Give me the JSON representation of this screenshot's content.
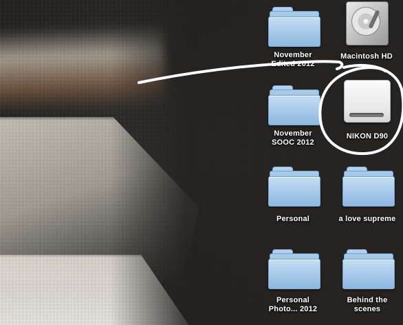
{
  "desktop": {
    "icons": [
      {
        "label": "November\nEdited 2012",
        "type": "folder"
      },
      {
        "label": "Macintosh HD",
        "type": "hard-drive"
      },
      {
        "label": "November\nSOOC 2012",
        "type": "folder"
      },
      {
        "label": "NIKON D90",
        "type": "external-drive"
      },
      {
        "label": "Personal",
        "type": "folder"
      },
      {
        "label": "a love supreme",
        "type": "folder"
      },
      {
        "label": "Personal\nPhoto... 2012",
        "type": "folder"
      },
      {
        "label": "Behind the\nscenes",
        "type": "folder"
      }
    ]
  },
  "annotation": {
    "stroke_color": "#ffffff"
  }
}
